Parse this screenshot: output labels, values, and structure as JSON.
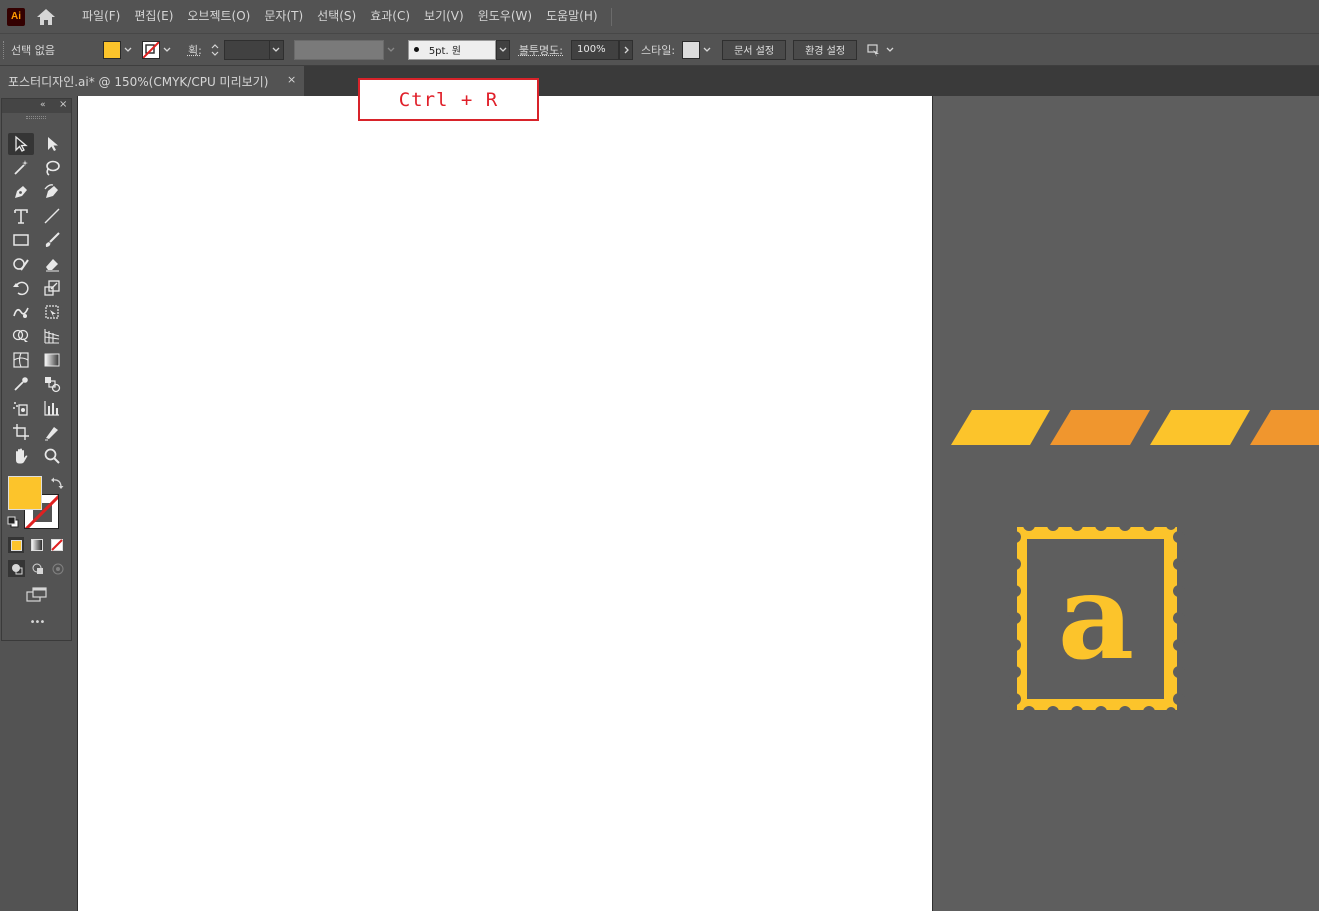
{
  "app": {
    "logo_text": "Ai"
  },
  "menu": {
    "items": [
      "파일(F)",
      "편집(E)",
      "오브젝트(O)",
      "문자(T)",
      "선택(S)",
      "효과(C)",
      "보기(V)",
      "윈도우(W)",
      "도움말(H)"
    ]
  },
  "control_bar": {
    "selection_label": "선택 없음",
    "fill_color": "#fcc42b",
    "stroke_label": "획:",
    "stroke_profile": "5pt. 원",
    "opacity_label": "불투명도:",
    "opacity_value": "100%",
    "style_label": "스타일:",
    "doc_setup_button": "문서 설정",
    "preferences_button": "환경 설정"
  },
  "tab": {
    "title": "포스터디자인.ai* @ 150%(CMYK/CPU 미리보기)",
    "close": "×"
  },
  "callout": {
    "text": "Ctrl + R"
  },
  "toolbar": {
    "fill_color": "#fcc42b",
    "dots": "•••"
  },
  "artwork": {
    "stripe_colors": [
      "#fcc42b",
      "#f0962e",
      "#fcc42b",
      "#f0962e"
    ],
    "stamp_letter": "a",
    "stamp_color": "#fcc42b"
  },
  "colors": {
    "ui_bg": "#535353",
    "pasteboard": "#5e5e5e",
    "artboard": "#ffffff",
    "callout_border": "#d8232a"
  }
}
